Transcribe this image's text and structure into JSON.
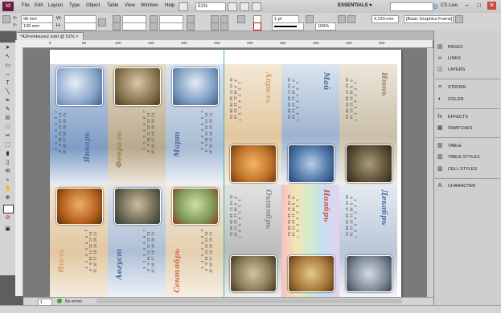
{
  "app": {
    "logo": "Id",
    "menus": [
      "File",
      "Edit",
      "Layout",
      "Type",
      "Object",
      "Table",
      "View",
      "Window",
      "Help"
    ],
    "zoom": "51%",
    "workspace": "ESSENTIALS",
    "workspace_arrow": "▾",
    "live_label": "CS Live",
    "win_min": "–",
    "win_max": "□",
    "win_close": "✕"
  },
  "control": {
    "x_label": "X:",
    "x_value": "98 mm",
    "y_label": "Y:",
    "y_value": "136 mm",
    "w_label": "W:",
    "h_label": "H:",
    "stroke_weight": "1 pt",
    "opacity": "100%",
    "gap_value": "4,233 mm",
    "frame_style": "[Basic Graphics Frame]"
  },
  "document": {
    "tab_title": "*A2ForHouse2.indd @ 51%",
    "tab_close": "×"
  },
  "ruler": {
    "labels": [
      "0",
      "50",
      "100",
      "150",
      "200",
      "250",
      "300",
      "350",
      "400",
      "450",
      "500"
    ]
  },
  "status": {
    "page": "1",
    "errors": "No errors"
  },
  "panels": [
    {
      "icon": "▤",
      "label": "PAGES"
    },
    {
      "icon": "∞",
      "label": "LINKS"
    },
    {
      "icon": "◫",
      "label": "LAYERS"
    },
    {
      "icon": "≡",
      "label": "STROKE"
    },
    {
      "icon": "◐",
      "label": "COLOR"
    },
    {
      "icon": "fx",
      "label": "EFFECTS"
    },
    {
      "icon": "▦",
      "label": "SWATCHES"
    },
    {
      "icon": "▥",
      "label": "TABLE"
    },
    {
      "icon": "▥",
      "label": "TABLE STYLES"
    },
    {
      "icon": "▥",
      "label": "CELL STYLES"
    },
    {
      "icon": "A",
      "label": "CHARACTER"
    }
  ],
  "calendar": {
    "months": [
      "Январь",
      "Февраль",
      "Март",
      "Апрель",
      "Май",
      "Июнь",
      "Июль",
      "Август",
      "Сентябрь",
      "Октябрь",
      "Ноябрь",
      "Декабрь"
    ],
    "grid_rows": [
      "   1  2  3  4  5  6  7",
      "  8  9 10 11 12 13 14",
      " 15 16 17 18 19 20 21",
      " 22 23 24 25 26 27 28",
      " 29 30 31"
    ],
    "weekdays": "Пн Вт Ср Чт Пт Сб Вс"
  }
}
